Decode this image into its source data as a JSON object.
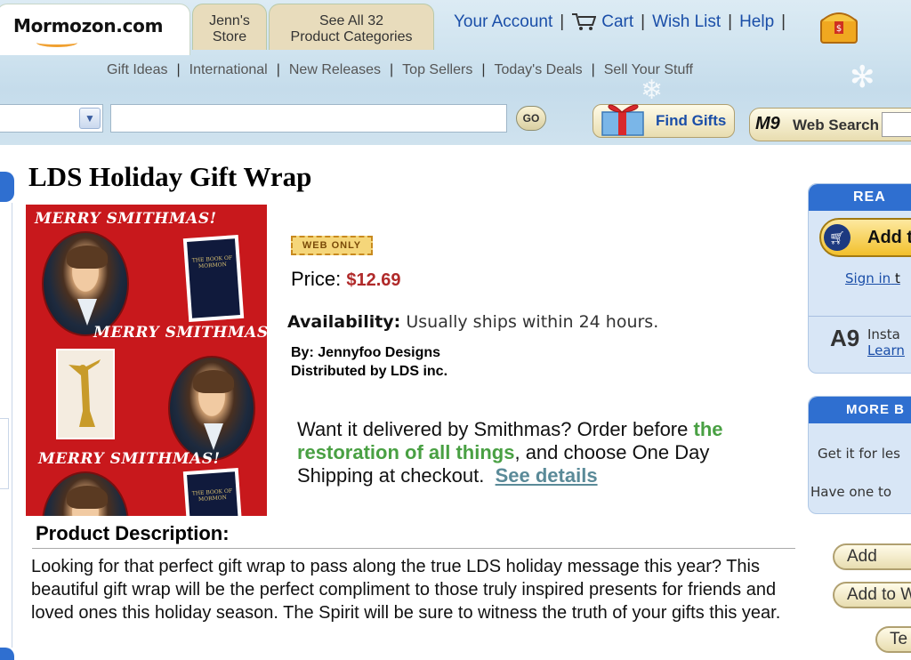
{
  "header": {
    "logo": "Mormozon.com",
    "tabs": [
      {
        "line1": "Jenn's",
        "line2": "Store"
      },
      {
        "line1": "See All 32",
        "line2": "Product Categories"
      }
    ],
    "account_links": [
      "Your Account",
      "Cart",
      "Wish List",
      "Help"
    ],
    "subnav": [
      "Gift Ideas",
      "International",
      "New Releases",
      "Top Sellers",
      "Today's Deals",
      "Sell Your Stuff"
    ],
    "search": {
      "go_label": "GO",
      "value": ""
    },
    "find_gifts_label": "Find Gifts",
    "web_search_label": "Web Search",
    "web_search_logo": "M9"
  },
  "product": {
    "title": "LDS Holiday Gift Wrap",
    "image_text": [
      "MERRY SMITHMAS!",
      "MERRY SMITHMAS!",
      "MERRY SMITHMAS!"
    ],
    "book_cover": "THE BOOK OF MORMON",
    "badge": "WEB ONLY",
    "price_label": "Price:",
    "price": "$12.69",
    "availability_label": "Availability:",
    "availability": "Usually ships within 24 hours.",
    "by": "By: Jennyfoo Designs",
    "distributed": "Distributed by LDS inc.",
    "delivery": {
      "part1": "Want it delivered by Smithmas?  Order before",
      "highlight": "the restoration of all things",
      "part2": ", and choose One Day Shipping at checkout.",
      "link": "See details"
    },
    "description_heading": "Product Description:",
    "description": "Looking for that perfect gift wrap to pass along the true LDS holiday message this year?  This beautiful gift wrap will be the perfect compliment to those truly inspired presents for friends and loved ones this holiday season.  The Spirit will be sure to witness the truth of your gifts this year."
  },
  "sidebar": {
    "ready_heading": "REA",
    "add_button": "Add t",
    "sign_in": "Sign in",
    "sign_in_tail": "t",
    "a9_logo": "A9",
    "insta": "Insta",
    "learn": "Learn",
    "more_heading": "MORE B",
    "get_it": "Get it for les",
    "have_one": "Have one to",
    "buttons": [
      "Add",
      "Add to W",
      "Te"
    ]
  },
  "colors": {
    "accent_blue": "#2f6fd0",
    "price_red": "#b02a2a",
    "link_blue": "#1a4ea8",
    "highlight_green": "#49a043",
    "wrap_red": "#c8181c"
  }
}
